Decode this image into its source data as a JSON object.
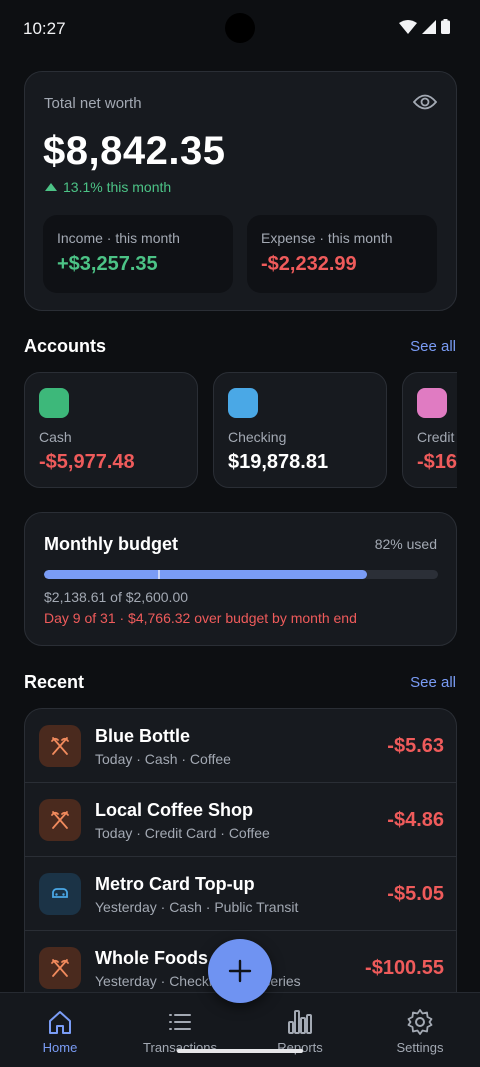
{
  "status_bar": {
    "time": "10:27"
  },
  "net_worth": {
    "label": "Total net worth",
    "value": "$8,842.35",
    "change": "13.1% this month",
    "income_label": "Income · this month",
    "income_value": "+$3,257.35",
    "expense_label": "Expense · this month",
    "expense_value": "-$2,232.99"
  },
  "accounts": {
    "title": "Accounts",
    "see_all": "See all",
    "items": [
      {
        "name": "Cash",
        "balance": "-$5,977.48",
        "color": "#3db87a"
      },
      {
        "name": "Checking",
        "balance": "$19,878.81",
        "color": "#4aa8e6"
      },
      {
        "name": "Credit",
        "balance": "-$16",
        "color": "#e07bc2"
      }
    ]
  },
  "budget": {
    "title": "Monthly budget",
    "used": "82% used",
    "progress_fraction": 0.82,
    "day_marker_fraction": 0.29,
    "amount": "$2,138.61 of $2,600.00",
    "warning": "Day 9 of 31 · $4,766.32 over budget by month end"
  },
  "recent": {
    "title": "Recent",
    "see_all": "See all",
    "items": [
      {
        "name": "Blue Bottle",
        "meta": "Today · Cash · Coffee",
        "amount": "-$5.63",
        "icon": "utensils-icon"
      },
      {
        "name": "Local Coffee Shop",
        "meta": "Today · Credit Card · Coffee",
        "amount": "-$4.86",
        "icon": "utensils-icon"
      },
      {
        "name": "Metro Card Top-up",
        "meta": "Yesterday · Cash · Public Transit",
        "amount": "-$5.05",
        "icon": "car-icon"
      },
      {
        "name": "Whole Foods",
        "meta": "Yesterday · Checking · Groceries",
        "amount": "-$100.55",
        "icon": "utensils-icon"
      }
    ]
  },
  "nav": {
    "items": [
      {
        "label": "Home",
        "icon": "home-icon",
        "active": true
      },
      {
        "label": "Transactions",
        "icon": "list-icon",
        "active": false
      },
      {
        "label": "Reports",
        "icon": "bar-chart-icon",
        "active": false
      },
      {
        "label": "Settings",
        "icon": "gear-icon",
        "active": false
      }
    ]
  },
  "colors": {
    "accent": "#7a9cf5",
    "positive": "#4cc386",
    "negative": "#ef5b5b",
    "background": "#0d0f12"
  }
}
